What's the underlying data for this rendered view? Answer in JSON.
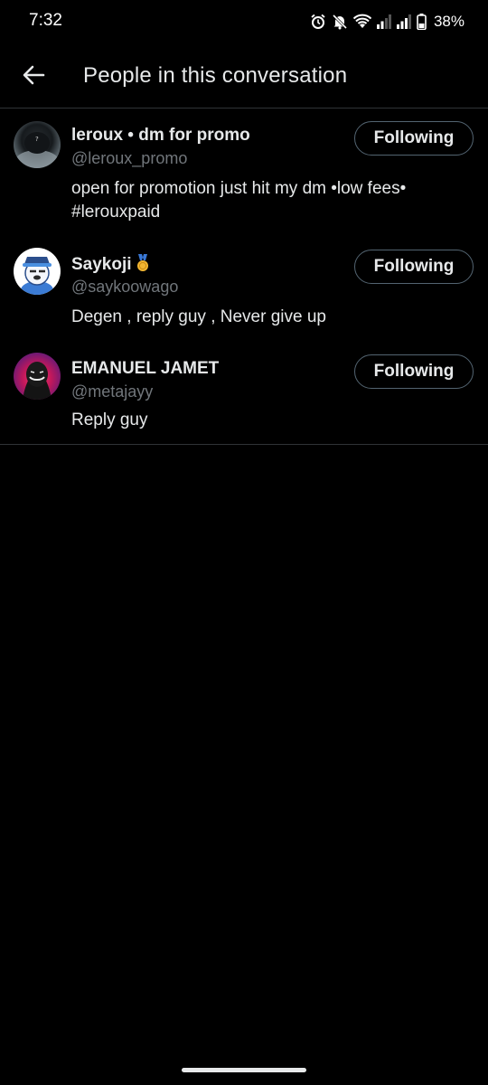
{
  "status_bar": {
    "time": "7:32",
    "battery": "38%",
    "icons": [
      "alarm-icon",
      "mute-icon",
      "wifi-icon",
      "signal-icon",
      "signal-icon",
      "battery-icon"
    ]
  },
  "header": {
    "title": "People in this conversation",
    "back_icon": "arrow-left-icon"
  },
  "users": [
    {
      "name": "leroux • dm for promo",
      "handle": "@leroux_promo",
      "bio": "open for promotion just hit my dm •low fees• #lerouxpaid",
      "follow_label": "Following"
    },
    {
      "name": "Saykoji",
      "handle": "@saykoowago",
      "bio": "Degen , reply guy , Never give up",
      "follow_label": "Following",
      "badge": "medal-icon"
    },
    {
      "name": "EMANUEL JAMET",
      "handle": "@metajayy",
      "bio": "Reply guy",
      "follow_label": "Following"
    }
  ],
  "colors": {
    "background": "#000000",
    "text_primary": "#e7e9ea",
    "text_secondary": "#71767b",
    "divider": "#2f3336",
    "button_border": "#536471"
  }
}
